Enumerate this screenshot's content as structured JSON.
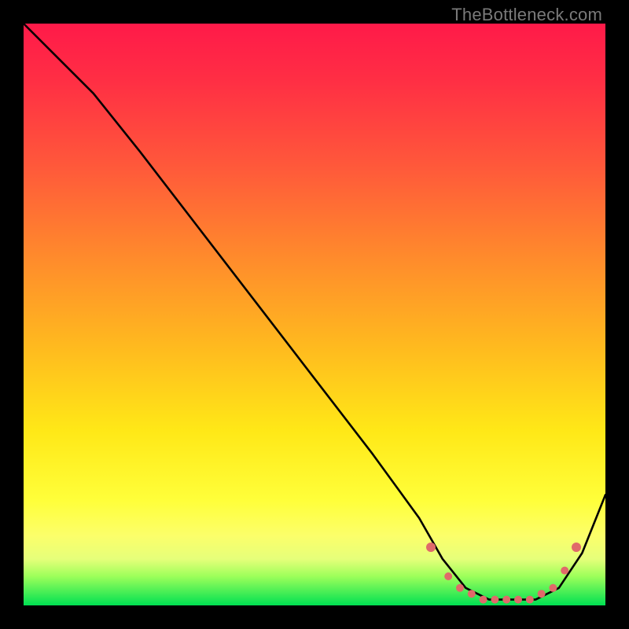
{
  "watermark": "TheBottleneck.com",
  "chart_data": {
    "type": "line",
    "title": "",
    "xlabel": "",
    "ylabel": "",
    "xlim": [
      0,
      100
    ],
    "ylim": [
      0,
      100
    ],
    "grid": false,
    "legend": false,
    "series": [
      {
        "name": "bottleneck-curve",
        "color": "#000000",
        "x": [
          0,
          6,
          12,
          20,
          30,
          40,
          50,
          60,
          68,
          72,
          76,
          80,
          84,
          88,
          92,
          96,
          100
        ],
        "y": [
          100,
          94,
          88,
          78,
          65,
          52,
          39,
          26,
          15,
          8,
          3,
          1,
          1,
          1,
          3,
          9,
          19
        ]
      }
    ],
    "marker_points": {
      "name": "highlighted-range",
      "color": "#e06a6a",
      "x": [
        70,
        73,
        75,
        77,
        79,
        81,
        83,
        85,
        87,
        89,
        91,
        93,
        95
      ],
      "y": [
        10,
        5,
        3,
        2,
        1,
        1,
        1,
        1,
        1,
        2,
        3,
        6,
        10
      ]
    }
  },
  "colors": {
    "frame": "#000000",
    "curve": "#000000",
    "marker": "#e06a6a"
  }
}
